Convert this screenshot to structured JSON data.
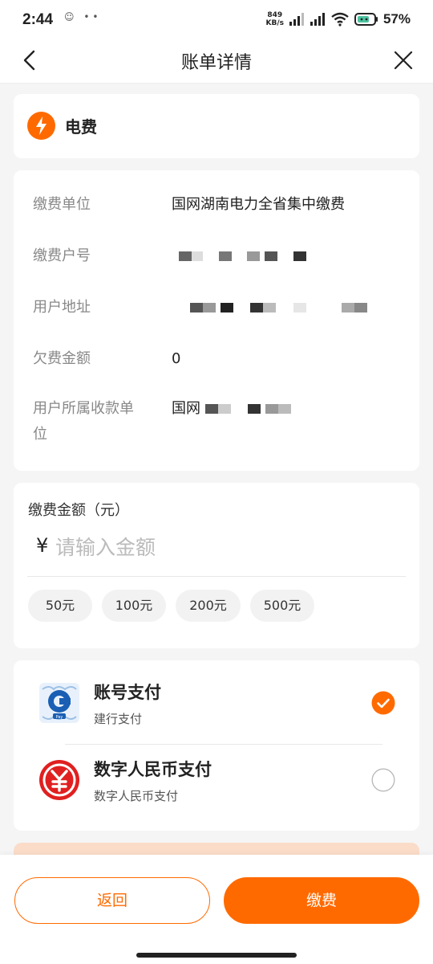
{
  "status_bar": {
    "time": "2:44",
    "speed_value": "849",
    "speed_unit": "KB/s",
    "battery": "57%"
  },
  "nav": {
    "title": "账单详情",
    "back_icon": "chevron-left-icon",
    "close_icon": "close-icon"
  },
  "bill": {
    "title": "电费",
    "icon": "lightning-icon",
    "rows": [
      {
        "label": "缴费单位",
        "value": "国网湖南电力全省集中缴费"
      },
      {
        "label": "缴费户号",
        "value": ""
      },
      {
        "label": "用户地址",
        "value": ""
      },
      {
        "label": "欠费金额",
        "value": "0"
      },
      {
        "label": "用户所属收款单位",
        "value": "国网"
      }
    ]
  },
  "amount": {
    "label": "缴费金额（元）",
    "currency_symbol": "¥",
    "placeholder": "请输入金额",
    "value": "",
    "quick_options": [
      "50元",
      "100元",
      "200元",
      "500元"
    ]
  },
  "payment_methods": [
    {
      "name": "账号支付",
      "sub": "建行支付",
      "icon": "ccb-pay-icon",
      "selected": true
    },
    {
      "name": "数字人民币支付",
      "sub": "数字人民币支付",
      "icon": "digital-rmb-icon",
      "selected": false
    }
  ],
  "actions": {
    "back_label": "返回",
    "pay_label": "缴费"
  },
  "colors": {
    "accent": "#ff6a00",
    "digital_rmb_red": "#e02020",
    "ccb_blue": "#1a5fb4"
  }
}
